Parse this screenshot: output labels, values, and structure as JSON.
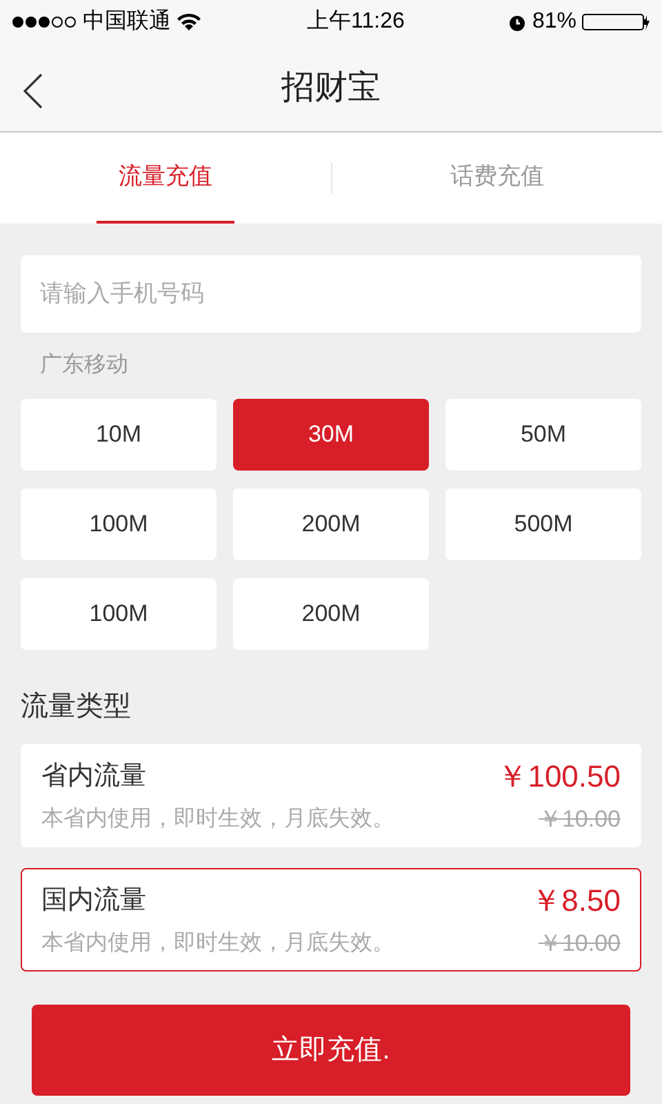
{
  "status_bar": {
    "carrier": "中国联通",
    "time": "上午11:26",
    "battery": "81%"
  },
  "nav": {
    "title": "招财宝"
  },
  "tabs": [
    {
      "label": "流量充值",
      "selected": true
    },
    {
      "label": "话费充值",
      "selected": false
    }
  ],
  "phone_field": {
    "placeholder": "请输入手机号码"
  },
  "operator": "广东移动",
  "packages": [
    {
      "label": "10M",
      "selected": false
    },
    {
      "label": "30M",
      "selected": true
    },
    {
      "label": "50M",
      "selected": false
    },
    {
      "label": "100M",
      "selected": false
    },
    {
      "label": "200M",
      "selected": false
    },
    {
      "label": "500M",
      "selected": false
    },
    {
      "label": "100M",
      "selected": false
    },
    {
      "label": "200M",
      "selected": false
    }
  ],
  "type_heading": "流量类型",
  "types": [
    {
      "name": "省内流量",
      "description": "本省内使用，即时生效，月底失效。",
      "price": "￥100.50",
      "original_price": "￥10.00",
      "selected": false
    },
    {
      "name": "国内流量",
      "description": "本省内使用，即时生效，月底失效。",
      "price": "￥8.50",
      "original_price": "￥10.00",
      "selected": true
    }
  ],
  "submit": "立即充值."
}
